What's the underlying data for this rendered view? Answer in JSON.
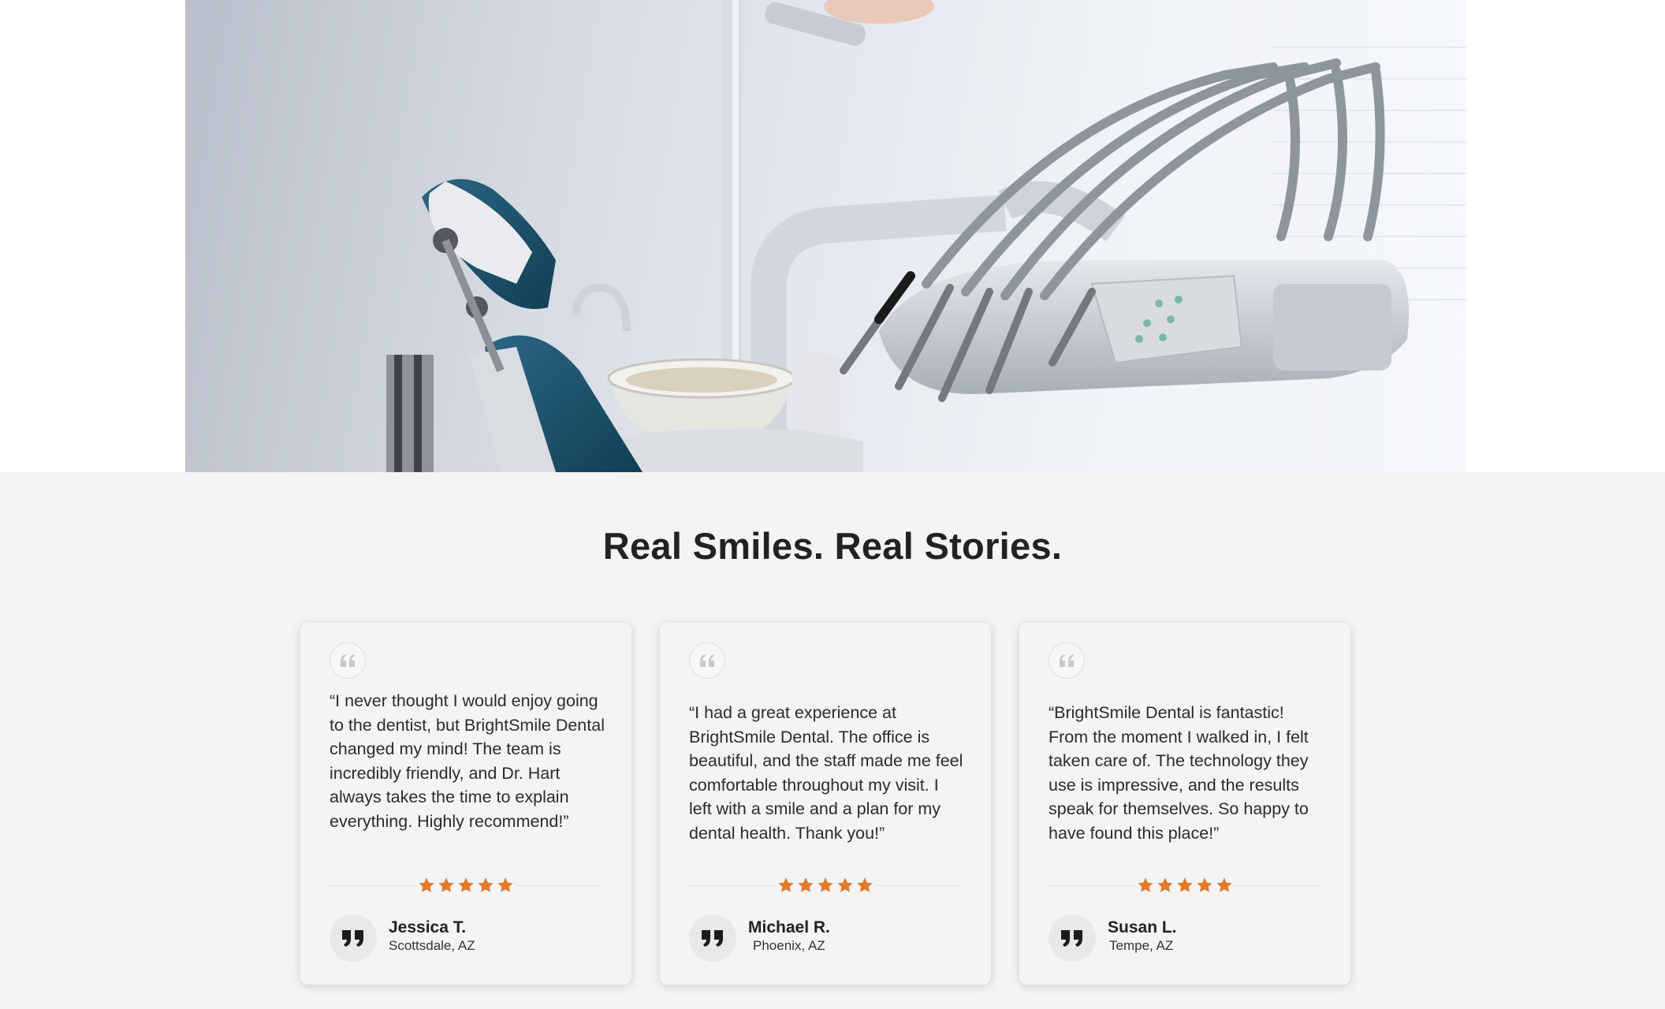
{
  "colors": {
    "background": "#f4f4f4",
    "card": "#f4f4f4",
    "star": "#e07b2e",
    "title": "#222222",
    "dental_chair_accent": "#1d5670"
  },
  "hero": {
    "image": "dental-operatory-photo"
  },
  "testimonials": {
    "title": "Real Smiles. Real Stories.",
    "cards": [
      {
        "quote": "“I never thought I would enjoy going to the dentist, but BrightSmile Dental changed my mind! The team is incredibly friendly, and Dr. Hart always takes the time to explain everything. Highly recommend!”",
        "rating": 5,
        "name": "Jessica T.",
        "location": "Scottsdale, AZ",
        "icon": "quote-icon"
      },
      {
        "quote": "“I had a great experience at BrightSmile Dental. The office is beautiful, and the staff made me feel comfortable throughout my visit. I left with a smile and a plan for my dental health. Thank you!”",
        "rating": 5,
        "name": "Michael R.",
        "location": "Phoenix, AZ",
        "icon": "quote-icon"
      },
      {
        "quote": "“BrightSmile Dental is fantastic! From the moment I walked in, I felt taken care of. The technology they use is impressive, and the results speak for themselves. So happy to have found this place!”",
        "rating": 5,
        "name": "Susan L.",
        "location": "Tempe, AZ",
        "icon": "quote-icon"
      }
    ]
  }
}
